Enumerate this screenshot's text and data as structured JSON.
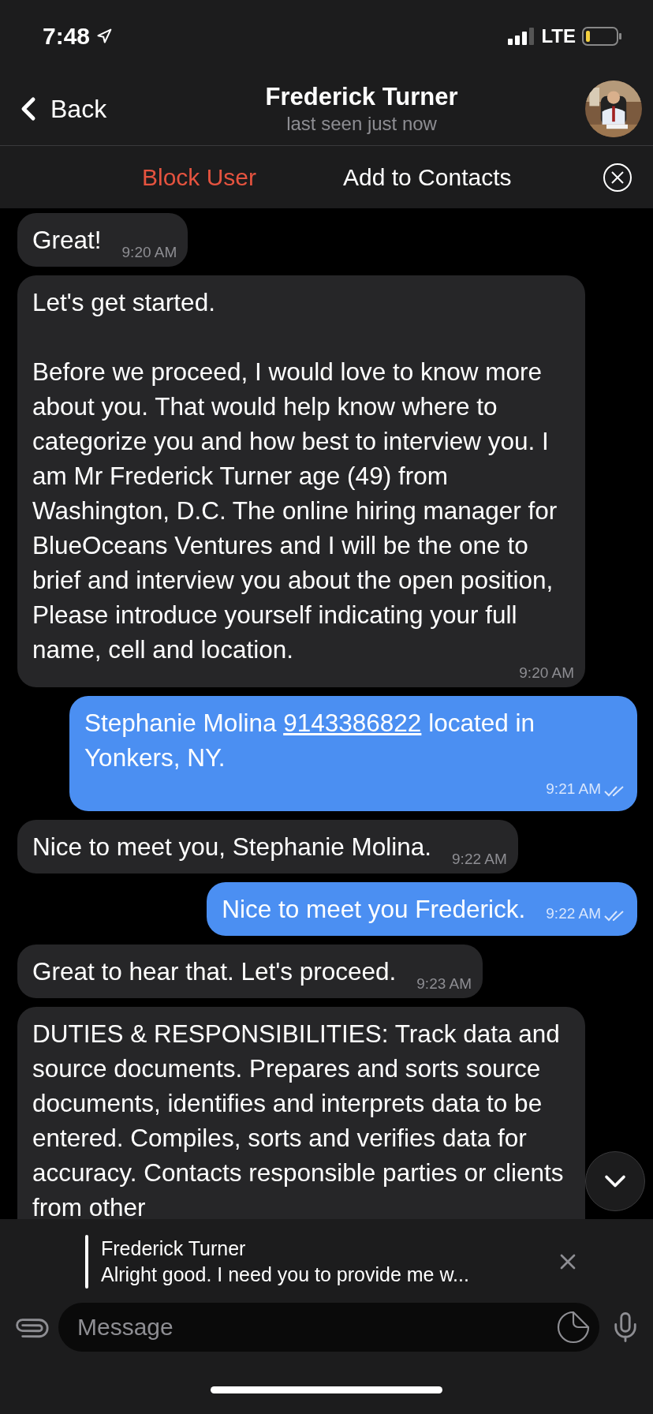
{
  "status_bar": {
    "time": "7:48",
    "network": "LTE"
  },
  "header": {
    "back": "Back",
    "title": "Frederick Turner",
    "subtitle": "last seen just now"
  },
  "action_bar": {
    "block": "Block User",
    "add": "Add to Contacts"
  },
  "messages": [
    {
      "kind": "incoming",
      "paragraphs": [
        "Great!"
      ],
      "time": "9:20 AM"
    },
    {
      "kind": "incoming",
      "paragraphs": [
        "Let's get started.",
        "Before we proceed, I would love to know more about you. That would help know where to categorize you and how best to interview you. I am Mr Frederick Turner age (49) from Washington, D.C. The online hiring manager for BlueOceans Ventures and I will be the one to brief and interview you about the open position, Please introduce yourself indicating your full name, cell and location."
      ],
      "time": "9:20 AM"
    },
    {
      "kind": "outgoing",
      "before": "Stephanie Molina ",
      "link": "9143386822",
      "after": " located in Yonkers, NY.",
      "time": "9:21 AM",
      "read": true
    },
    {
      "kind": "incoming",
      "paragraphs": [
        "Nice to meet you, Stephanie Molina."
      ],
      "time": "9:22 AM"
    },
    {
      "kind": "outgoing",
      "paragraphs": [
        "Nice to meet you Frederick."
      ],
      "time": "9:22 AM",
      "read": true
    },
    {
      "kind": "incoming",
      "paragraphs": [
        "Great to hear that. Let's proceed."
      ],
      "time": "9:23 AM"
    },
    {
      "kind": "incoming",
      "paragraphs": [
        "DUTIES & RESPONSIBILITIES: Track data and source documents. Prepares and sorts source documents, identifies and interprets data to be entered. Compiles, sorts and verifies data for accuracy. Contacts responsible parties or clients from other"
      ]
    }
  ],
  "reply": {
    "name": "Frederick Turner",
    "text": "Alright good. I need you to provide me w..."
  },
  "composer": {
    "placeholder": "Message"
  }
}
